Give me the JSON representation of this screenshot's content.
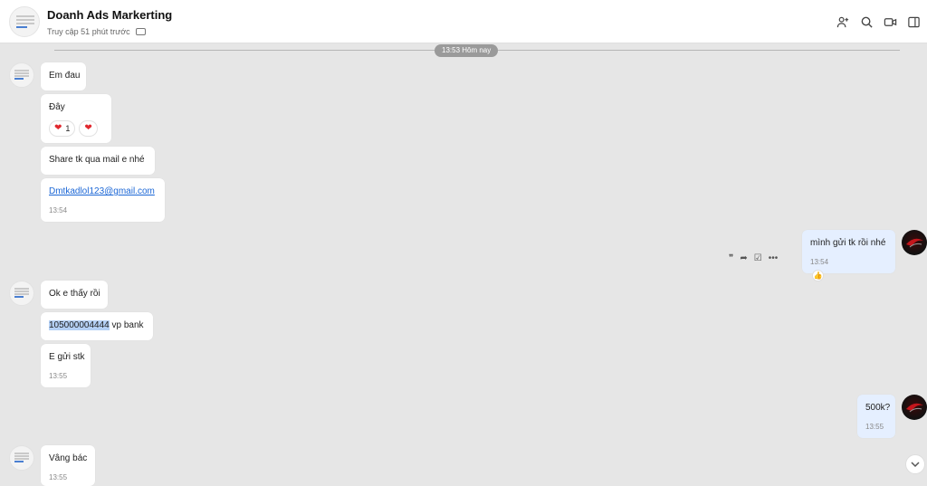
{
  "header": {
    "title": "Doanh Ads Markerting",
    "status": "Truy cập 51 phút trước"
  },
  "divider": {
    "label": "13:53 Hôm nay"
  },
  "messages": [
    {
      "text": "Em đau"
    },
    {
      "text": "Đây",
      "reactions": [
        {
          "icon": "❤️",
          "count": "1"
        },
        {
          "icon": "❤️"
        }
      ]
    },
    {
      "text": "Share tk qua mail e nhé"
    },
    {
      "text": "Dmtkadlol123@gmail.com",
      "time": "13:54"
    },
    {
      "text": "mình gửi tk rồi nhé",
      "time": "13:54"
    },
    {
      "text": "Ok e thấy rồi"
    },
    {
      "highlight": "105000004444",
      "text": " vp bank"
    },
    {
      "text": "E gửi stk",
      "time": "13:55"
    },
    {
      "text": "500k?",
      "time": "13:55"
    },
    {
      "text": "Vâng bác",
      "time": "13:55"
    }
  ],
  "icons": {
    "add_member": "user-plus-icon",
    "search": "search-icon",
    "video": "video-call-icon",
    "sidebar": "sidebar-toggle-icon"
  },
  "colors": {
    "chat_bg": "#e6e6e6",
    "my_bubble": "#e5efff",
    "link": "#1a66d6",
    "heart": "#e0282e"
  }
}
